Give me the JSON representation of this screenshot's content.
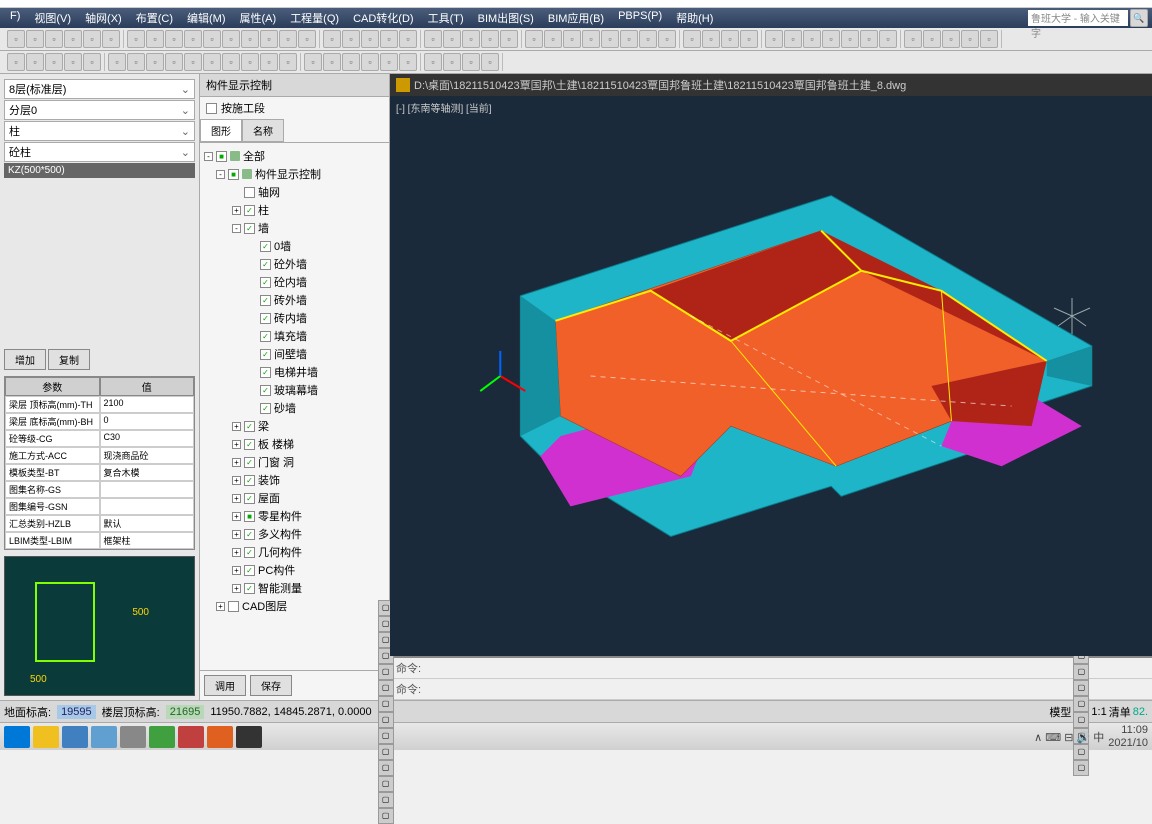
{
  "menubar": {
    "items": [
      "F)",
      "视图(V)",
      "轴网(X)",
      "布置(C)",
      "编辑(M)",
      "属性(A)",
      "工程量(Q)",
      "CAD转化(D)",
      "工具(T)",
      "BIM出图(S)",
      "BIM应用(B)",
      "PBPS(P)",
      "帮助(H)"
    ],
    "search_placeholder": "鲁班大学 - 输入关键字"
  },
  "left_panel": {
    "floor": "8层(标准层)",
    "layer": "分层0",
    "type1": "柱",
    "type2": "砼柱",
    "element": "KZ(500*500)",
    "btn_add": "增加",
    "btn_copy": "复制",
    "param_headers": [
      "参数",
      "值"
    ],
    "params": [
      [
        "梁层 顶标高(mm)-TH",
        "2100"
      ],
      [
        "梁层 底标高(mm)-BH",
        "0"
      ],
      [
        "砼等级-CG",
        "C30"
      ],
      [
        "施工方式-ACC",
        "现浇商品砼"
      ],
      [
        "模板类型-BT",
        "复合木模"
      ],
      [
        "图集名称-GS",
        ""
      ],
      [
        "图集编号-GSN",
        ""
      ],
      [
        "汇总类别-HZLB",
        "默认"
      ],
      [
        "LBIM类型-LBIM",
        "框架柱"
      ]
    ],
    "dims": {
      "h": "500",
      "v": "500"
    }
  },
  "mid_panel": {
    "title": "构件显示控制",
    "check_label": "按施工段",
    "tabs": [
      "图形",
      "名称"
    ],
    "btn_apply": "调用",
    "btn_save": "保存",
    "tree": [
      {
        "lvl": 0,
        "exp": "-",
        "cb": "■",
        "label": "全部",
        "ico": 1
      },
      {
        "lvl": 1,
        "exp": "-",
        "cb": "■",
        "label": "构件显示控制",
        "ico": 1
      },
      {
        "lvl": 2,
        "exp": "",
        "cb": "☐",
        "label": "轴网"
      },
      {
        "lvl": 2,
        "exp": "+",
        "cb": "☑",
        "label": "柱"
      },
      {
        "lvl": 2,
        "exp": "-",
        "cb": "☑",
        "label": "墙"
      },
      {
        "lvl": 3,
        "exp": "",
        "cb": "☑",
        "label": "0墙"
      },
      {
        "lvl": 3,
        "exp": "",
        "cb": "☑",
        "label": "砼外墙"
      },
      {
        "lvl": 3,
        "exp": "",
        "cb": "☑",
        "label": "砼内墙"
      },
      {
        "lvl": 3,
        "exp": "",
        "cb": "☑",
        "label": "砖外墙"
      },
      {
        "lvl": 3,
        "exp": "",
        "cb": "☑",
        "label": "砖内墙"
      },
      {
        "lvl": 3,
        "exp": "",
        "cb": "☑",
        "label": "填充墙"
      },
      {
        "lvl": 3,
        "exp": "",
        "cb": "☑",
        "label": "间壁墙"
      },
      {
        "lvl": 3,
        "exp": "",
        "cb": "☑",
        "label": "电梯井墙"
      },
      {
        "lvl": 3,
        "exp": "",
        "cb": "☑",
        "label": "玻璃幕墙"
      },
      {
        "lvl": 3,
        "exp": "",
        "cb": "☑",
        "label": "砂墙"
      },
      {
        "lvl": 2,
        "exp": "+",
        "cb": "☑",
        "label": "梁"
      },
      {
        "lvl": 2,
        "exp": "+",
        "cb": "☑",
        "label": "板 楼梯"
      },
      {
        "lvl": 2,
        "exp": "+",
        "cb": "☑",
        "label": "门窗 洞"
      },
      {
        "lvl": 2,
        "exp": "+",
        "cb": "☑",
        "label": "装饰"
      },
      {
        "lvl": 2,
        "exp": "+",
        "cb": "☑",
        "label": "屋面"
      },
      {
        "lvl": 2,
        "exp": "+",
        "cb": "■",
        "label": "零星构件"
      },
      {
        "lvl": 2,
        "exp": "+",
        "cb": "☑",
        "label": "多义构件"
      },
      {
        "lvl": 2,
        "exp": "+",
        "cb": "☑",
        "label": "几何构件"
      },
      {
        "lvl": 2,
        "exp": "+",
        "cb": "☑",
        "label": "PC构件"
      },
      {
        "lvl": 2,
        "exp": "+",
        "cb": "☑",
        "label": "智能测量"
      },
      {
        "lvl": 1,
        "exp": "+",
        "cb": "☐",
        "label": "CAD图层"
      }
    ]
  },
  "right_panel": {
    "file_path": "D:\\桌面\\18211510423覃国邦\\土建\\18211510423覃国邦鲁班土建\\18211510423覃国邦鲁班土建_8.dwg",
    "view_label": "[-] [东南等轴测] [当前]",
    "cmd_label": "命令:"
  },
  "statusbar": {
    "ground_label": "地面标高:",
    "ground": "19595",
    "top_label": "楼层顶标高:",
    "top": "21695",
    "coords": "11950.7882, 14845.2871, 0.0000",
    "scale": "1:1",
    "tray_label": "清单",
    "tray_pct": "82."
  },
  "taskbar": {
    "time": "11:09",
    "date": "2021/10",
    "ime": "中"
  }
}
